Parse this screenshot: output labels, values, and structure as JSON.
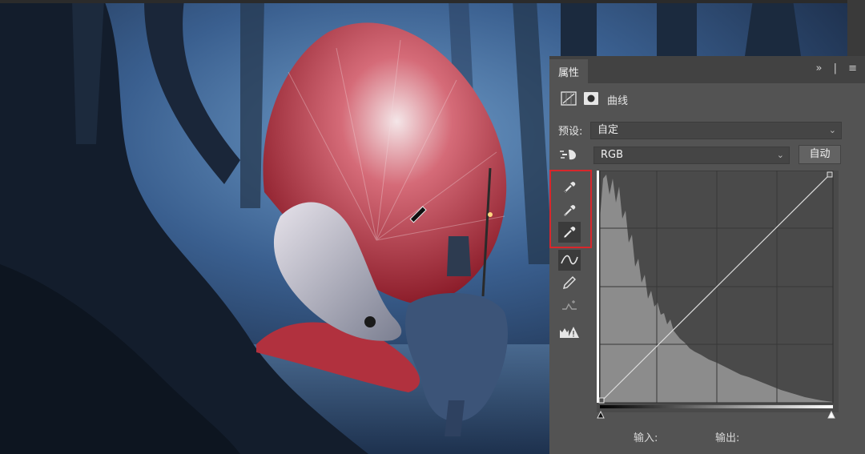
{
  "panel": {
    "tab_label": "属性",
    "expand_label": "»",
    "menu_label": "≡",
    "adjustment_title": "曲线",
    "preset_label": "预设:",
    "preset_value": "自定",
    "channel_value": "RGB",
    "auto_button": "自动",
    "input_label": "输入:",
    "output_label": "输出:"
  },
  "tools": [
    {
      "name": "sample-black-point-icon"
    },
    {
      "name": "sample-gray-point-icon"
    },
    {
      "name": "sample-white-point-icon",
      "selected": true
    },
    {
      "name": "curve-edit-points-icon",
      "selected": true
    },
    {
      "name": "pencil-draw-icon"
    },
    {
      "name": "smooth-curve-icon"
    },
    {
      "name": "clipping-warning-icon"
    }
  ],
  "colors": {
    "panel_bg": "#535353",
    "highlight": "#d9262b"
  }
}
